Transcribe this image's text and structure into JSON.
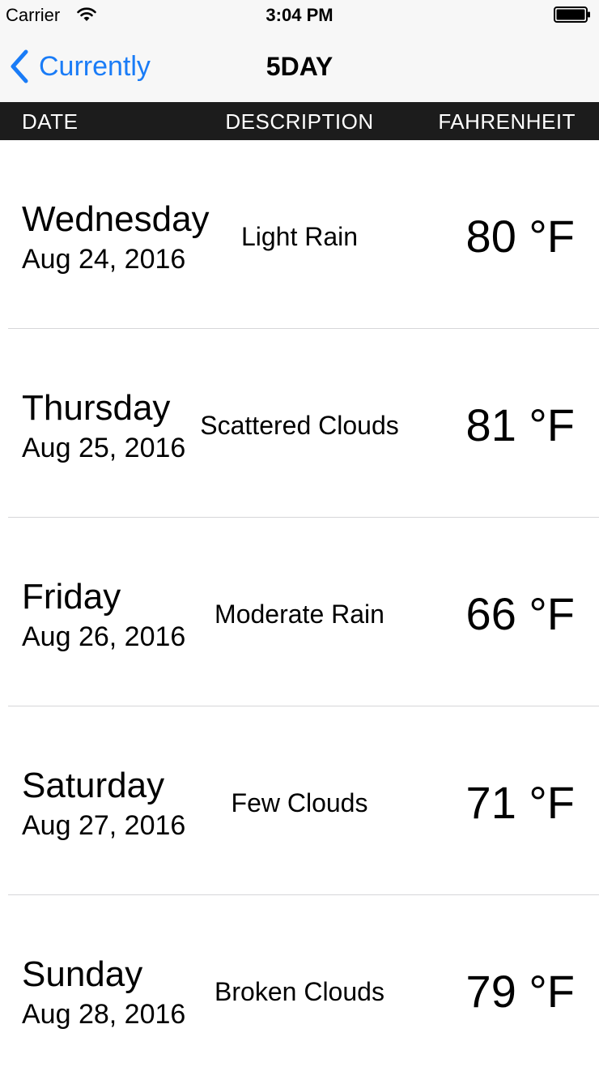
{
  "status_bar": {
    "carrier": "Carrier",
    "time": "3:04 PM",
    "wifi_icon": "wifi-icon",
    "battery_icon": "battery-icon"
  },
  "nav": {
    "back_label": "Currently",
    "title": "5DAY",
    "accent_color": "#1a7cf7"
  },
  "table_header": {
    "date": "DATE",
    "description": "DESCRIPTION",
    "fahrenheit": "FAHRENHEIT"
  },
  "forecast": [
    {
      "day": "Wednesday",
      "date": "Aug 24, 2016",
      "description": "Light Rain",
      "temp": "80 °F"
    },
    {
      "day": "Thursday",
      "date": "Aug 25, 2016",
      "description": "Scattered Clouds",
      "temp": "81 °F"
    },
    {
      "day": "Friday",
      "date": "Aug 26, 2016",
      "description": "Moderate Rain",
      "temp": "66 °F"
    },
    {
      "day": "Saturday",
      "date": "Aug 27, 2016",
      "description": "Few Clouds",
      "temp": "71 °F"
    },
    {
      "day": "Sunday",
      "date": "Aug 28, 2016",
      "description": "Broken Clouds",
      "temp": "79 °F"
    }
  ]
}
